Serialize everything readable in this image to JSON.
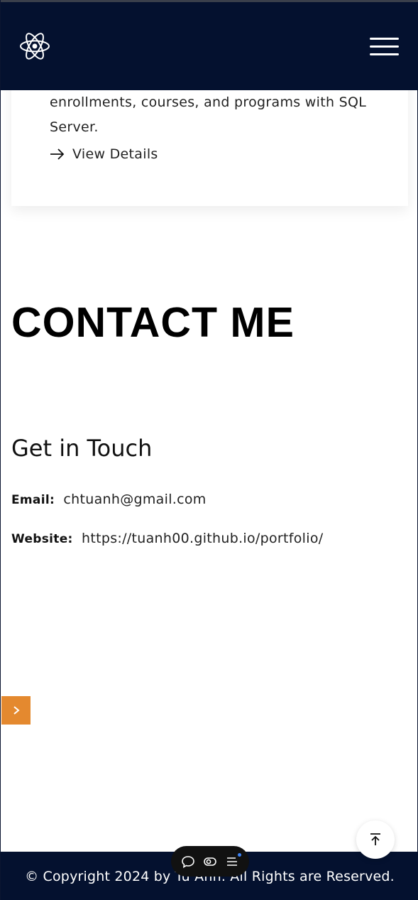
{
  "header": {
    "logo_icon": "react-atom-icon",
    "menu_icon": "hamburger-menu-icon"
  },
  "project_card": {
    "description": "enrollments, courses, and programs with SQL Server.",
    "view_details_label": "View Details"
  },
  "contact": {
    "section_title": "CONTACT ME",
    "subtitle": "Get in Touch",
    "email_label": "Email:",
    "email_value": "chtuanh@gmail.com",
    "website_label": "Website:",
    "website_value": "https://tuanh00.github.io/portfolio/"
  },
  "footer": {
    "copyright": "© Copyright 2024 by Tu Anh. All Rights are Reserved."
  },
  "floating": {
    "side_tab_icon": "chevron-right-icon",
    "scroll_top_icon": "arrow-up-to-top-icon",
    "toolbar_icons": [
      "chat-bubble-icon",
      "toggle-icon",
      "list-menu-icon"
    ]
  },
  "colors": {
    "header_bg": "#04112f",
    "accent": "#e4892f",
    "text": "#222222"
  }
}
